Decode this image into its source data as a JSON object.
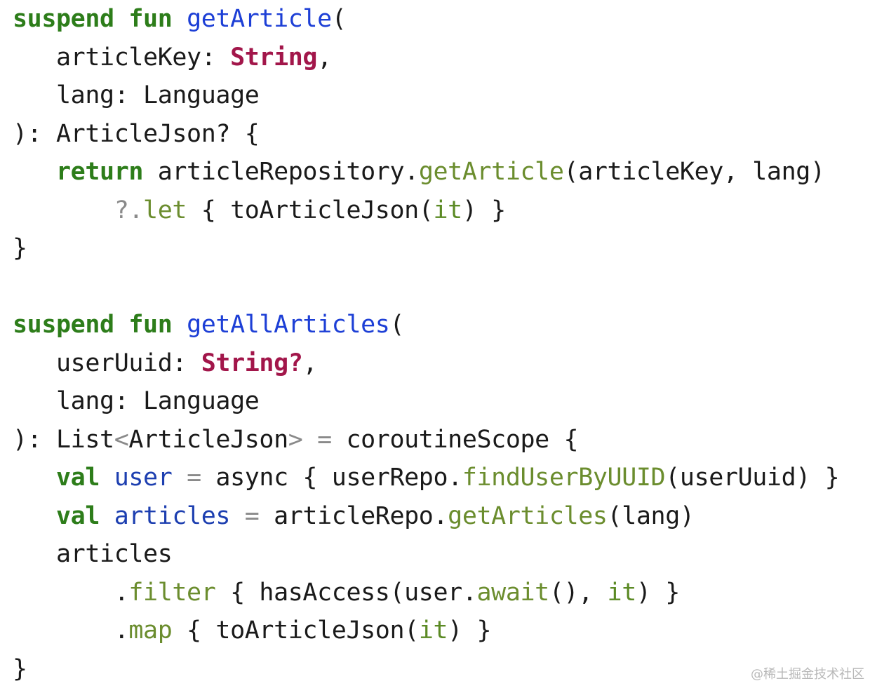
{
  "colors": {
    "keyword": "#2d7d1a",
    "function_definition": "#1d3fd6",
    "primitive_type": "#a2164a",
    "method_call": "#6b8d2e",
    "operator": "#8a8a8a",
    "local_variable": "#1d3fb0",
    "implicit_it": "#5b8a24",
    "plain": "#1a1a1a",
    "background": "#ffffff"
  },
  "code": {
    "language": "kotlin",
    "lines": [
      [
        {
          "t": "suspend",
          "k": "kw"
        },
        {
          "t": " ",
          "k": "plain"
        },
        {
          "t": "fun",
          "k": "kw"
        },
        {
          "t": " ",
          "k": "plain"
        },
        {
          "t": "getArticle",
          "k": "fn-def"
        },
        {
          "t": "(",
          "k": "plain"
        }
      ],
      [
        {
          "t": "   articleKey: ",
          "k": "plain"
        },
        {
          "t": "String",
          "k": "type-prim"
        },
        {
          "t": ",",
          "k": "plain"
        }
      ],
      [
        {
          "t": "   lang: Language",
          "k": "plain"
        }
      ],
      [
        {
          "t": "): ArticleJson? {",
          "k": "plain"
        }
      ],
      [
        {
          "t": "   ",
          "k": "plain"
        },
        {
          "t": "return",
          "k": "kw"
        },
        {
          "t": " articleRepository.",
          "k": "plain"
        },
        {
          "t": "getArticle",
          "k": "call"
        },
        {
          "t": "(articleKey, lang)",
          "k": "plain"
        }
      ],
      [
        {
          "t": "       ",
          "k": "plain"
        },
        {
          "t": "?.",
          "k": "op"
        },
        {
          "t": "let",
          "k": "call"
        },
        {
          "t": " { toArticleJson(",
          "k": "plain"
        },
        {
          "t": "it",
          "k": "it"
        },
        {
          "t": ") }",
          "k": "plain"
        }
      ],
      [
        {
          "t": "}",
          "k": "plain"
        }
      ],
      [
        {
          "t": "",
          "k": "plain"
        }
      ],
      [
        {
          "t": "suspend",
          "k": "kw"
        },
        {
          "t": " ",
          "k": "plain"
        },
        {
          "t": "fun",
          "k": "kw"
        },
        {
          "t": " ",
          "k": "plain"
        },
        {
          "t": "getAllArticles",
          "k": "fn-def"
        },
        {
          "t": "(",
          "k": "plain"
        }
      ],
      [
        {
          "t": "   userUuid: ",
          "k": "plain"
        },
        {
          "t": "String?",
          "k": "type-prim"
        },
        {
          "t": ",",
          "k": "plain"
        }
      ],
      [
        {
          "t": "   lang: Language",
          "k": "plain"
        }
      ],
      [
        {
          "t": "): List",
          "k": "plain"
        },
        {
          "t": "<",
          "k": "op"
        },
        {
          "t": "ArticleJson",
          "k": "plain"
        },
        {
          "t": ">",
          "k": "op"
        },
        {
          "t": " ",
          "k": "plain"
        },
        {
          "t": "=",
          "k": "op"
        },
        {
          "t": " coroutineScope {",
          "k": "plain"
        }
      ],
      [
        {
          "t": "   ",
          "k": "plain"
        },
        {
          "t": "val",
          "k": "kw"
        },
        {
          "t": " ",
          "k": "plain"
        },
        {
          "t": "user",
          "k": "param"
        },
        {
          "t": " ",
          "k": "plain"
        },
        {
          "t": "=",
          "k": "op"
        },
        {
          "t": " async { userRepo.",
          "k": "plain"
        },
        {
          "t": "findUserByUUID",
          "k": "call"
        },
        {
          "t": "(userUuid) }",
          "k": "plain"
        }
      ],
      [
        {
          "t": "   ",
          "k": "plain"
        },
        {
          "t": "val",
          "k": "kw"
        },
        {
          "t": " ",
          "k": "plain"
        },
        {
          "t": "articles",
          "k": "param"
        },
        {
          "t": " ",
          "k": "plain"
        },
        {
          "t": "=",
          "k": "op"
        },
        {
          "t": " articleRepo.",
          "k": "plain"
        },
        {
          "t": "getArticles",
          "k": "call"
        },
        {
          "t": "(lang)",
          "k": "plain"
        }
      ],
      [
        {
          "t": "   articles",
          "k": "plain"
        }
      ],
      [
        {
          "t": "       .",
          "k": "plain"
        },
        {
          "t": "filter",
          "k": "call"
        },
        {
          "t": " { hasAccess(user.",
          "k": "plain"
        },
        {
          "t": "await",
          "k": "call"
        },
        {
          "t": "(), ",
          "k": "plain"
        },
        {
          "t": "it",
          "k": "it"
        },
        {
          "t": ") }",
          "k": "plain"
        }
      ],
      [
        {
          "t": "       .",
          "k": "plain"
        },
        {
          "t": "map",
          "k": "call"
        },
        {
          "t": " { toArticleJson(",
          "k": "plain"
        },
        {
          "t": "it",
          "k": "it"
        },
        {
          "t": ") }",
          "k": "plain"
        }
      ],
      [
        {
          "t": "}",
          "k": "plain"
        }
      ]
    ]
  },
  "watermark": {
    "text": "@稀土掘金技术社区"
  }
}
